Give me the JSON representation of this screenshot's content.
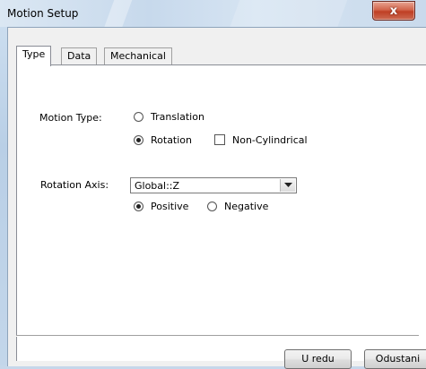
{
  "window": {
    "title": "Motion Setup",
    "close_label": "x"
  },
  "tabs": [
    {
      "label": "Type",
      "active": true
    },
    {
      "label": "Data",
      "active": false
    },
    {
      "label": "Mechanical",
      "active": false
    }
  ],
  "motion_type": {
    "label": "Motion Type:",
    "options": [
      {
        "label": "Translation",
        "selected": false
      },
      {
        "label": "Rotation",
        "selected": true
      }
    ],
    "non_cylindrical": {
      "label": "Non-Cylindrical",
      "checked": false
    }
  },
  "rotation_axis": {
    "label": "Rotation Axis:",
    "value": "Global::Z",
    "direction": [
      {
        "label": "Positive",
        "selected": true
      },
      {
        "label": "Negative",
        "selected": false
      }
    ]
  },
  "buttons": {
    "ok": "U redu",
    "cancel": "Odustani"
  }
}
